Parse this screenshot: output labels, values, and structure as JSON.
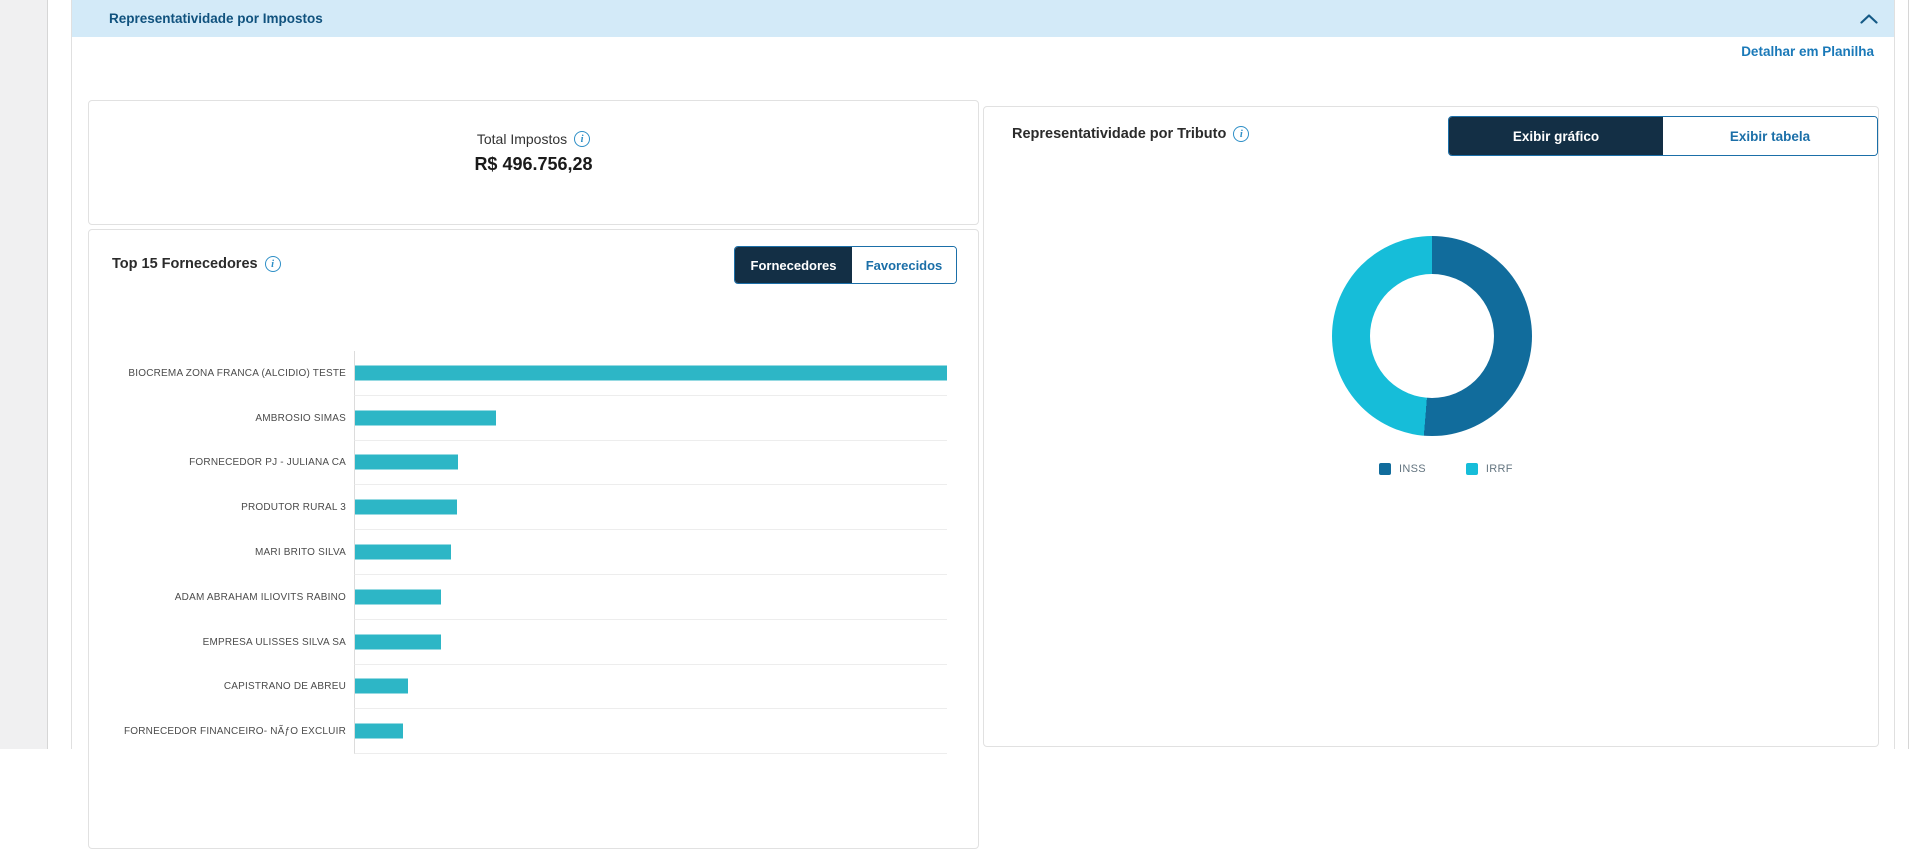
{
  "header": {
    "title": "Representatividade por Impostos"
  },
  "toolbar": {
    "detail_link": "Detalhar em Planilha"
  },
  "total_card": {
    "label": "Total Impostos",
    "value": "R$ 496.756,28",
    "info_icon": "i"
  },
  "suppliers_card": {
    "title": "Top 15 Fornecedores",
    "info_icon": "i",
    "toggle": {
      "active_label": "Fornecedores",
      "inactive_label": "Favorecidos"
    }
  },
  "tribute_card": {
    "title": "Representatividade por Tributo",
    "info_icon": "i",
    "toggle": {
      "active_label": "Exibir gráfico",
      "inactive_label": "Exibir tabela"
    }
  },
  "colors": {
    "header_bg": "#d3eaf8",
    "header_text": "#10527e",
    "link_blue": "#1a79b8",
    "toggle_dark": "#132f45",
    "toggle_blue_text": "#1b6fa8",
    "bar_teal": "#2db6c6",
    "donut_inss": "#116c9c",
    "donut_irrf": "#16bdd9"
  },
  "chart_data": [
    {
      "type": "bar",
      "orientation": "horizontal",
      "title": "Top 15 Fornecedores",
      "categories": [
        "BIOCREMA ZONA FRANCA (ALCIDIO) TESTE",
        "AMBROSIO SIMAS",
        "FORNECEDOR PJ - JULIANA CA",
        "PRODUTOR RURAL 3",
        "MARI BRITO SILVA",
        "ADAM ABRAHAM ILIOVITS RABINO",
        "EMPRESA ULISSES SILVA SA",
        "CAPISTRANO DE ABREU",
        "FORNECEDOR FINANCEIRO- NÃƒO EXCLUIR"
      ],
      "values_pct_of_max": [
        100,
        23.9,
        17.4,
        17.2,
        16.2,
        14.5,
        14.5,
        8.9,
        8.1
      ],
      "bar_color": "#2db6c6",
      "xlabel": "",
      "ylabel": "",
      "grid": "row-separators",
      "note": "no numeric axis labels visible; values are relative bar lengths, list truncated by viewport"
    },
    {
      "type": "pie",
      "subtype": "donut",
      "title": "Representatividade por Tributo",
      "labels": [
        "INSS",
        "IRRF"
      ],
      "values_pct": [
        51.3,
        48.7
      ],
      "colors": [
        "#116c9c",
        "#16bdd9"
      ],
      "legend_position": "bottom",
      "note": "percentages estimated from arc angles; no data labels visible"
    }
  ]
}
